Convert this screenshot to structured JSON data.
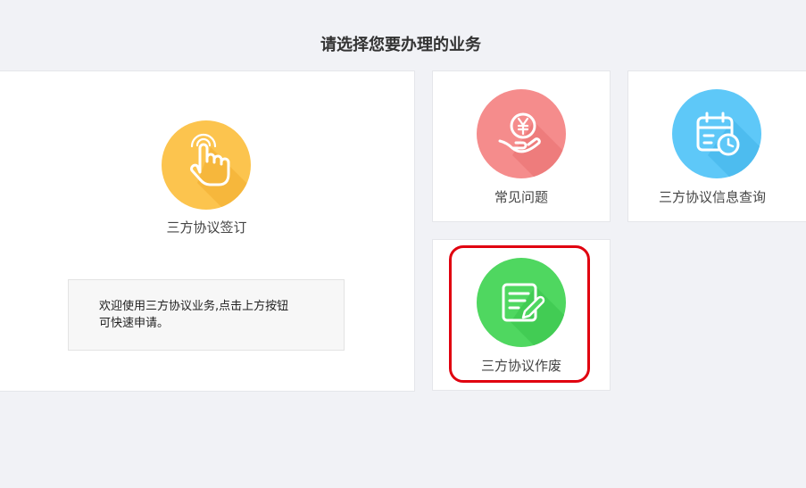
{
  "page": {
    "title": "请选择您要办理的业务"
  },
  "cards": {
    "sign": {
      "label": "三方协议签订",
      "icon": "hand-pointer-icon",
      "color": "#fcc44e"
    },
    "faq": {
      "label": "常见问题",
      "icon": "yuan-hand-icon",
      "color": "#f58c8c"
    },
    "query": {
      "label": "三方协议信息查询",
      "icon": "calendar-clock-icon",
      "color": "#5ec8f8"
    },
    "void": {
      "label": "三方协议作废",
      "icon": "document-edit-icon",
      "color": "#4fd760"
    }
  },
  "notice": {
    "line1": "欢迎使用三方协议业务,点击上方按钮",
    "line2": "可快速申请。"
  },
  "highlight": {
    "color": "#e0000f"
  }
}
